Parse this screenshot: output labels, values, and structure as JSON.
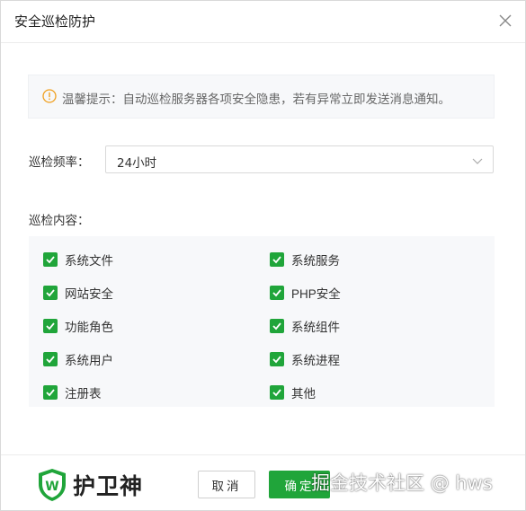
{
  "dialog": {
    "title": "安全巡检防护",
    "notice": "温馨提示：自动巡检服务器各项安全隐患，若有异常立即发送消息通知。",
    "frequency_label": "巡检频率：",
    "frequency_value": "24小时",
    "content_label": "巡检内容：",
    "checkboxes": [
      {
        "label": "系统文件",
        "checked": true
      },
      {
        "label": "系统服务",
        "checked": true
      },
      {
        "label": "网站安全",
        "checked": true
      },
      {
        "label": "PHP安全",
        "checked": true
      },
      {
        "label": "功能角色",
        "checked": true
      },
      {
        "label": "系统组件",
        "checked": true
      },
      {
        "label": "系统用户",
        "checked": true
      },
      {
        "label": "系统进程",
        "checked": true
      },
      {
        "label": "注册表",
        "checked": true
      },
      {
        "label": "其他",
        "checked": true
      }
    ],
    "cancel_label": "取消",
    "ok_label": "确定"
  },
  "footer": {
    "brand": "护卫神",
    "watermark": "掘金技术社区 @ hws"
  },
  "colors": {
    "accent": "#20a53a",
    "warning": "#f0a020"
  },
  "icons": {
    "close": "close-icon",
    "warning": "warning-icon",
    "dropdown": "chevron-down-icon",
    "check": "check-icon",
    "logo": "shield-logo-icon"
  }
}
